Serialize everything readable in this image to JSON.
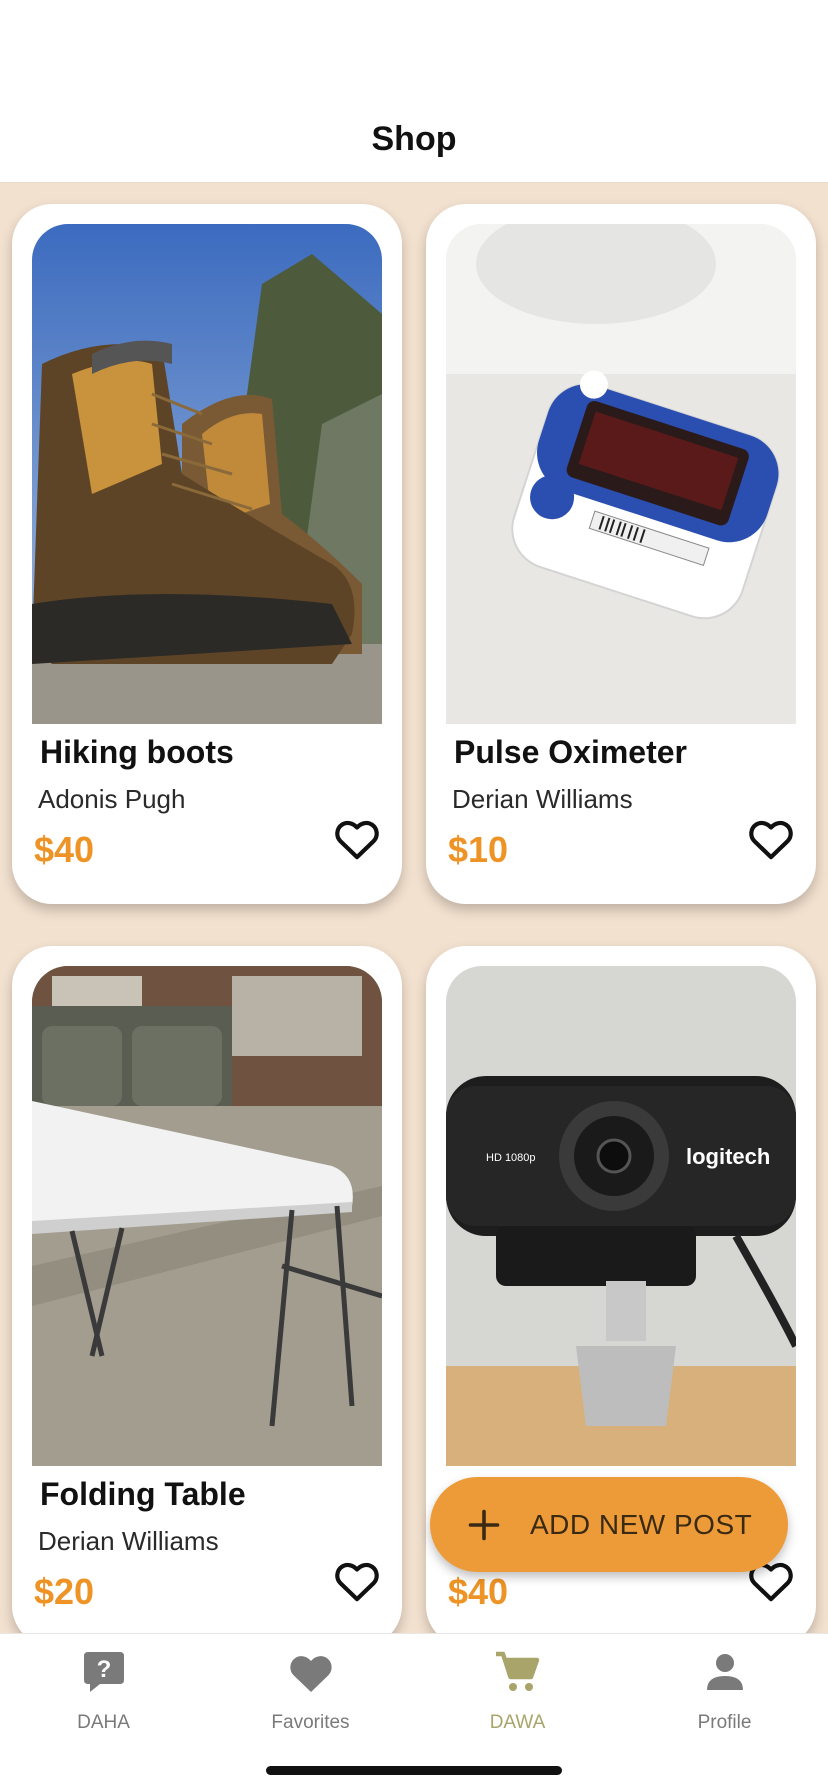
{
  "header": {
    "title": "Shop"
  },
  "colors": {
    "accent": "#ed9b38",
    "price": "#ee9326",
    "background": "#f3e1cf",
    "tab_active": "#a9a46a",
    "tab_inactive": "#7a7a7a"
  },
  "products": [
    {
      "title": "Hiking boots",
      "seller": "Adonis Pugh",
      "price": "$40",
      "image": "hiking-boots-photo",
      "favorite_icon": "heart-outline-icon"
    },
    {
      "title": "Pulse Oximeter",
      "seller": "Derian Williams",
      "price": "$10",
      "image": "pulse-oximeter-photo",
      "favorite_icon": "heart-outline-icon"
    },
    {
      "title": "Folding Table",
      "seller": "Derian Williams",
      "price": "$20",
      "image": "folding-table-photo",
      "favorite_icon": "heart-outline-icon"
    },
    {
      "title": "",
      "seller": "",
      "price": "$40",
      "image": "webcam-photo",
      "favorite_icon": "heart-outline-icon"
    }
  ],
  "fab": {
    "label": "ADD NEW POST",
    "icon": "plus-icon"
  },
  "tabs": [
    {
      "label": "DAHA",
      "icon": "question-bubble-icon",
      "active": false
    },
    {
      "label": "Favorites",
      "icon": "heart-icon",
      "active": false
    },
    {
      "label": "DAWA",
      "icon": "cart-icon",
      "active": true
    },
    {
      "label": "Profile",
      "icon": "person-icon",
      "active": false
    }
  ]
}
